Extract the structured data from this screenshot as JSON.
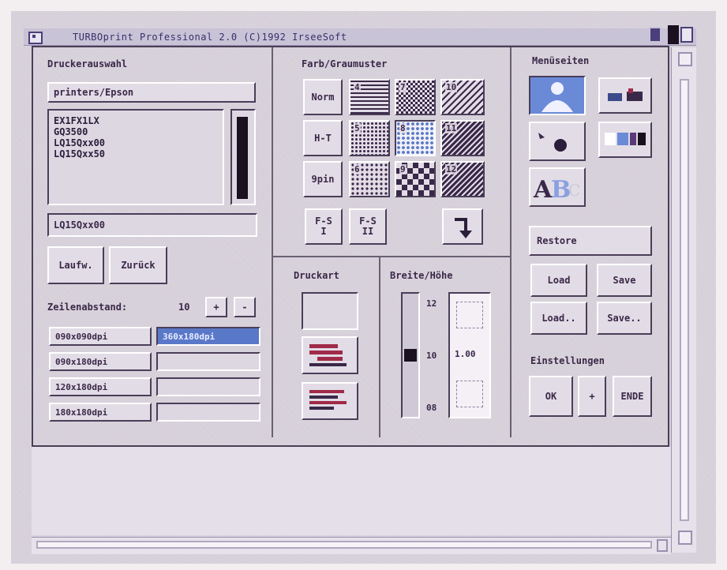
{
  "window": {
    "title": "TURBOprint Professional 2.0 (C)1992 IrseeSoft"
  },
  "printer_panel": {
    "heading": "Druckerauswahl",
    "path": "printers/Epson",
    "printers": [
      "EX1FX1LX",
      "GQ3500",
      "LQ15Qxx00",
      "LQ15Qxx50"
    ],
    "selected_printer": "LQ15Qxx00",
    "button_run": "Laufw.",
    "button_back": "Zurück",
    "line_spacing_label": "Zeilenabstand:",
    "line_spacing_value": "10",
    "plus": "+",
    "minus": "-",
    "resolutions": [
      "090x090dpi",
      "090x180dpi",
      "120x180dpi",
      "180x180dpi"
    ],
    "selected_resolution": "360x180dpi"
  },
  "pattern_panel": {
    "heading": "Farb/Graumuster",
    "buttons": [
      {
        "label": "Norm"
      },
      {
        "label": "4"
      },
      {
        "label": "7"
      },
      {
        "label": "10"
      },
      {
        "label": "H-T"
      },
      {
        "label": "5"
      },
      {
        "label": "8"
      },
      {
        "label": "11"
      },
      {
        "label": "9pin"
      },
      {
        "label": "6"
      },
      {
        "label": "9"
      },
      {
        "label": "12"
      }
    ],
    "fs1": "F-S\nI",
    "fs2": "F-S\nII"
  },
  "print_mode_panel": {
    "heading": "Druckart"
  },
  "size_panel": {
    "heading": "Breite/Höhe",
    "tick_top": "12",
    "tick_mid": "10",
    "tick_bottom": "08",
    "ratio": "1.00"
  },
  "menu_panel": {
    "heading": "Menüseiten",
    "restore": "Restore",
    "load": "Load",
    "save": "Save",
    "load_as": "Load..",
    "save_as": "Save..",
    "settings_heading": "Einstellungen",
    "ok": "OK",
    "plus": "+",
    "end": "ENDE"
  },
  "colors": {
    "accent": "#5a78c8",
    "background": "#d9d3dc",
    "dark": "#3a2848"
  }
}
